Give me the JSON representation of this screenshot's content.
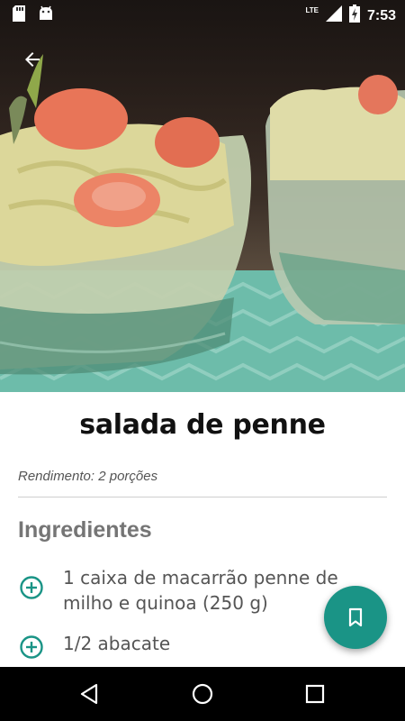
{
  "status_bar": {
    "network": "LTE",
    "time": "7:53"
  },
  "recipe": {
    "title": "salada de penne",
    "yield": "Rendimento: 2 porções",
    "ingredients_heading": "Ingredientes",
    "ingredients": [
      {
        "text": "1 caixa de macarrão penne de milho e quinoa (250 g)"
      },
      {
        "text": "1/2 abacate"
      }
    ]
  },
  "colors": {
    "accent": "#1a9486",
    "heading": "#757575",
    "text": "#555555"
  },
  "icons": {
    "back": "arrow-back-icon",
    "add": "add-circle-outline-icon",
    "bookmark": "bookmark-icon",
    "nav_back": "triangle-back-icon",
    "nav_home": "circle-home-icon",
    "nav_recents": "square-recents-icon"
  }
}
